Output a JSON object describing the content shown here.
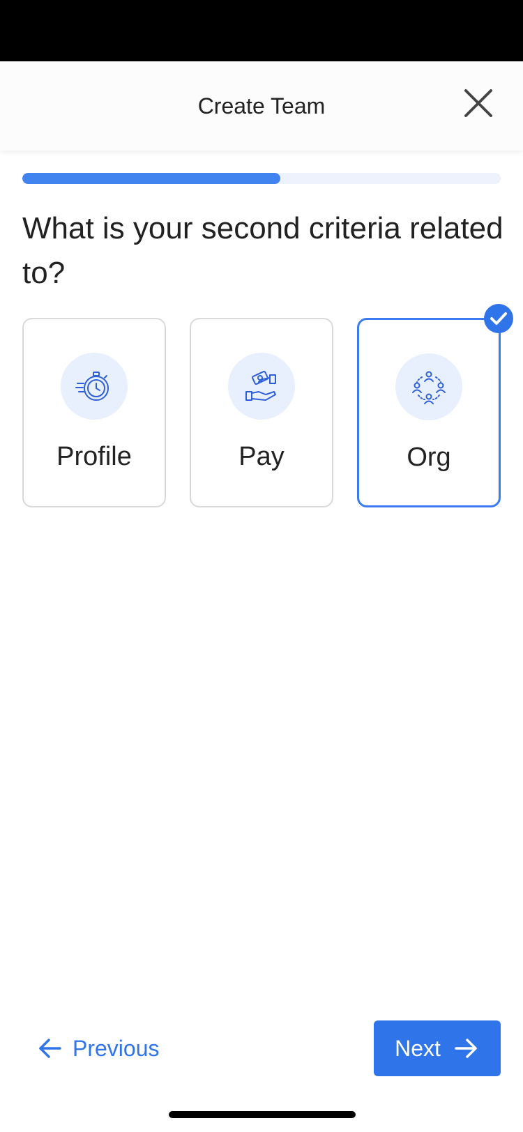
{
  "header": {
    "title": "Create Team",
    "close_icon": "close-icon"
  },
  "progress": {
    "fraction": 0.54,
    "color": "#4184f0",
    "track_color": "#edf2fc"
  },
  "question": "What is your second criteria related to?",
  "options": [
    {
      "label": "Profile",
      "icon": "stopwatch-icon",
      "selected": false
    },
    {
      "label": "Pay",
      "icon": "handshake-money-icon",
      "selected": false
    },
    {
      "label": "Org",
      "icon": "team-circle-icon",
      "selected": true
    }
  ],
  "footer": {
    "previous_label": "Previous",
    "previous_icon": "arrow-left-icon",
    "next_label": "Next",
    "next_icon": "arrow-right-icon"
  },
  "colors": {
    "accent": "#2f74e8",
    "icon_bg": "#e8f0fd"
  }
}
